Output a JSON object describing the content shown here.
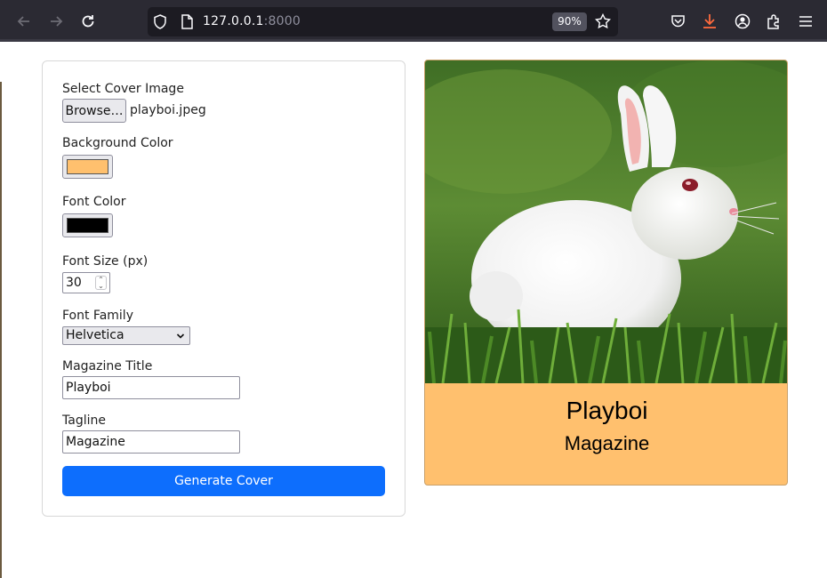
{
  "browser": {
    "url_host": "127.0.0.1",
    "url_port": ":8000",
    "zoom": "90%",
    "icons": [
      "back-arrow-icon",
      "forward-arrow-icon",
      "reload-icon",
      "shield-icon",
      "page-icon",
      "star-icon",
      "pocket-icon",
      "download-icon",
      "account-icon",
      "extensions-icon",
      "menu-icon"
    ]
  },
  "form": {
    "cover_image_label": "Select Cover Image",
    "browse_label": "Browse…",
    "file_name": "playboi.jpeg",
    "bg_color_label": "Background Color",
    "bg_color_value": "#ffc06e",
    "font_color_label": "Font Color",
    "font_color_value": "#000000",
    "font_size_label": "Font Size (px)",
    "font_size_value": "30",
    "font_family_label": "Font Family",
    "font_family_value": "Helvetica",
    "title_label": "Magazine Title",
    "title_value": "Playboi",
    "tagline_label": "Tagline",
    "tagline_value": "Magazine",
    "generate_label": "Generate Cover"
  },
  "preview": {
    "title": "Playboi",
    "tagline": "Magazine",
    "background": "#ffc06e",
    "image_subject": "white rabbit on grass"
  }
}
